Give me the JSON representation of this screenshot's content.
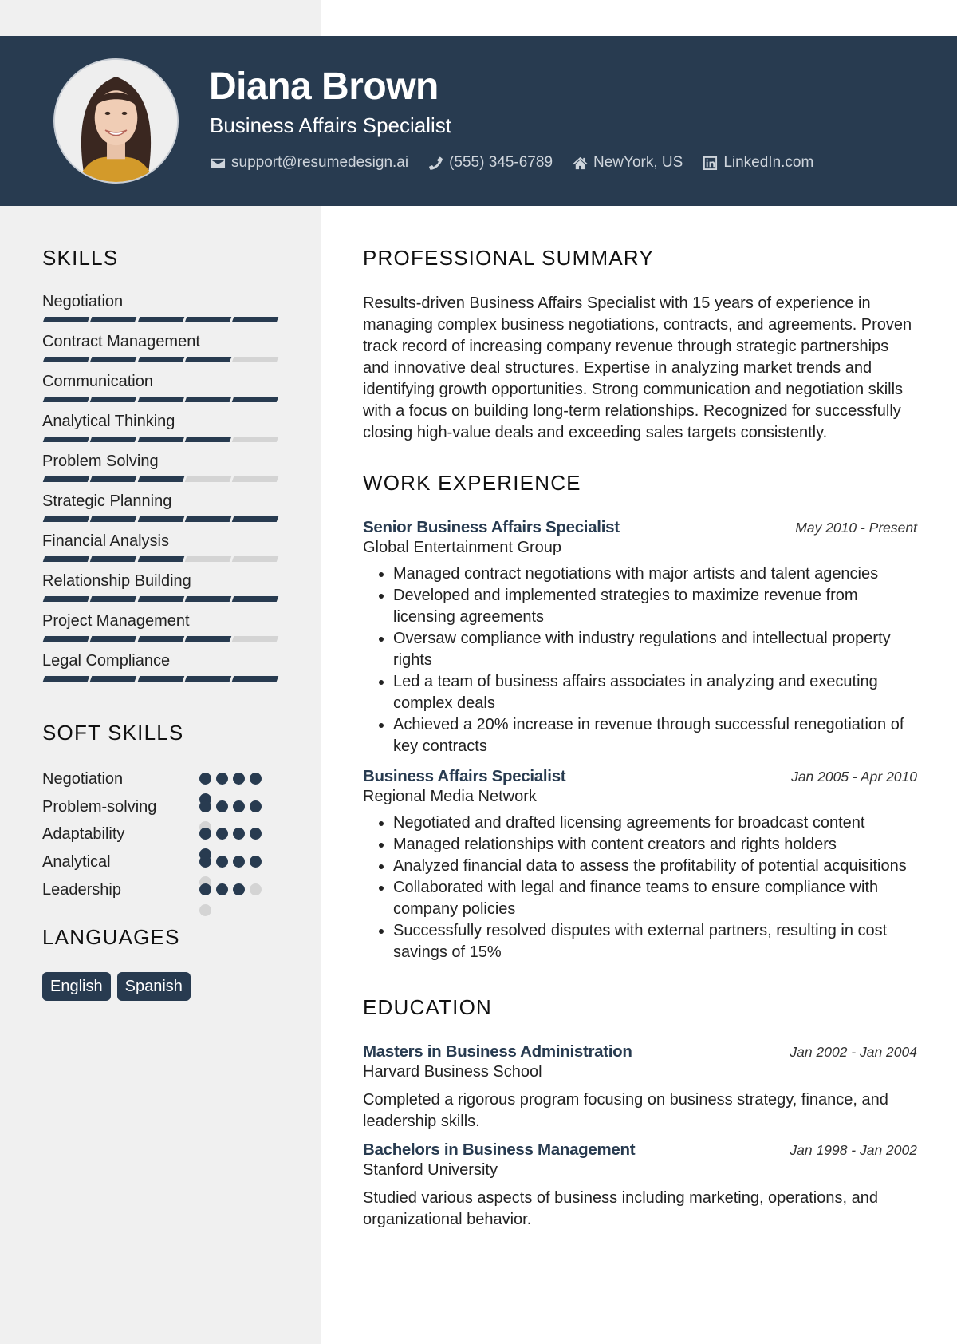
{
  "header": {
    "name": "Diana Brown",
    "title": "Business Affairs Specialist",
    "contacts": [
      {
        "icon": "envelope-icon",
        "text": "support@resumedesign.ai"
      },
      {
        "icon": "phone-icon",
        "text": "(555) 345-6789"
      },
      {
        "icon": "home-icon",
        "text": "NewYork, US"
      },
      {
        "icon": "linkedin-icon",
        "text": "LinkedIn.com"
      }
    ]
  },
  "colors": {
    "accent": "#283b50",
    "sidebar_bg": "#f0f0f0",
    "inactive": "#d4d4d4"
  },
  "sidebar": {
    "skills_title": "SKILLS",
    "skills": [
      {
        "label": "Negotiation",
        "level": 5,
        "max": 5
      },
      {
        "label": "Contract Management",
        "level": 4,
        "max": 5
      },
      {
        "label": "Communication",
        "level": 5,
        "max": 5
      },
      {
        "label": "Analytical Thinking",
        "level": 4,
        "max": 5
      },
      {
        "label": "Problem Solving",
        "level": 3,
        "max": 5
      },
      {
        "label": "Strategic Planning",
        "level": 5,
        "max": 5
      },
      {
        "label": "Financial Analysis",
        "level": 3,
        "max": 5
      },
      {
        "label": "Relationship Building",
        "level": 5,
        "max": 5
      },
      {
        "label": "Project Management",
        "level": 4,
        "max": 5
      },
      {
        "label": "Legal Compliance",
        "level": 5,
        "max": 5
      }
    ],
    "soft_skills_title": "SOFT SKILLS",
    "soft_skills": [
      {
        "label": "Negotiation",
        "level": 5,
        "max": 5
      },
      {
        "label": "Problem-solving",
        "level": 4,
        "max": 5
      },
      {
        "label": "Adaptability",
        "level": 5,
        "max": 5
      },
      {
        "label": "Analytical",
        "level": 4,
        "max": 5
      },
      {
        "label": "Leadership",
        "level": 3,
        "max": 5
      }
    ],
    "languages_title": "LANGUAGES",
    "languages": [
      "English",
      "Spanish"
    ]
  },
  "main": {
    "summary_title": "PROFESSIONAL SUMMARY",
    "summary": "Results-driven Business Affairs Specialist with 15 years of experience in managing complex business negotiations, contracts, and agreements. Proven track record of increasing company revenue through strategic partnerships and innovative deal structures. Expertise in analyzing market trends and identifying growth opportunities. Strong communication and negotiation skills with a focus on building long-term relationships. Recognized for successfully closing high-value deals and exceeding sales targets consistently.",
    "work_title": "WORK EXPERIENCE",
    "jobs": [
      {
        "role": "Senior Business Affairs Specialist",
        "date": "May 2010 - Present",
        "org": "Global Entertainment Group",
        "bullets": [
          "Managed contract negotiations with major artists and talent agencies",
          "Developed and implemented strategies to maximize revenue from licensing agreements",
          "Oversaw compliance with industry regulations and intellectual property rights",
          "Led a team of business affairs associates in analyzing and executing complex deals",
          "Achieved a 20% increase in revenue through successful renegotiation of key contracts"
        ]
      },
      {
        "role": "Business Affairs Specialist",
        "date": "Jan 2005 - Apr 2010",
        "org": "Regional Media Network",
        "bullets": [
          "Negotiated and drafted licensing agreements for broadcast content",
          "Managed relationships with content creators and rights holders",
          "Analyzed financial data to assess the profitability of potential acquisitions",
          "Collaborated with legal and finance teams to ensure compliance with company policies",
          "Successfully resolved disputes with external partners, resulting in cost savings of 15%"
        ]
      }
    ],
    "education_title": "EDUCATION",
    "education": [
      {
        "degree": "Masters in Business Administration",
        "date": "Jan 2002 - Jan 2004",
        "school": "Harvard Business School",
        "desc": "Completed a rigorous program focusing on business strategy, finance, and leadership skills."
      },
      {
        "degree": "Bachelors in Business Management",
        "date": "Jan 1998 - Jan 2002",
        "school": "Stanford University",
        "desc": "Studied various aspects of business including marketing, operations, and organizational behavior."
      }
    ]
  }
}
